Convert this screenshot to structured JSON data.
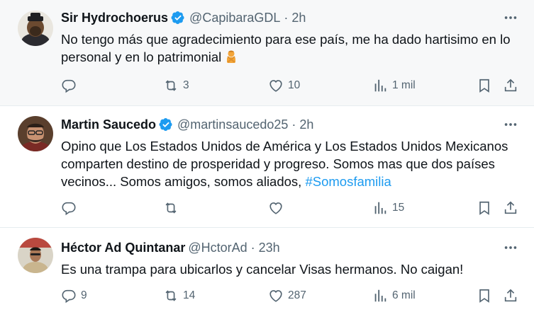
{
  "tweets": [
    {
      "name": "Sir Hydrochoerus",
      "handle": "@CapibaraGDL",
      "separator": "·",
      "time": "2h",
      "text": "No tengo más que  agradecimiento para ese país, me ha dado hartisimo en lo personal y en lo patrimonial",
      "emoji": "person-gesturing-no",
      "replies": "",
      "reposts": "3",
      "likes": "10",
      "views": "1 mil"
    },
    {
      "name": "Martin Saucedo",
      "handle": "@martinsaucedo25",
      "separator": "·",
      "time": "2h",
      "text": "Opino que Los Estados Unidos de América y Los Estados Unidos Mexicanos comparten destino de prosperidad y progreso.  Somos mas que dos países vecinos... Somos amigos, somos aliados, ",
      "hashtag": "#Somosfamilia",
      "replies": "",
      "reposts": "",
      "likes": "",
      "views": "15"
    },
    {
      "name": "Héctor Ad Quintanar",
      "handle": "@HctorAd",
      "separator": "·",
      "time": "23h",
      "text": "Es una trampa para ubicarlos y cancelar Visas hermanos. No caigan!",
      "replies": "9",
      "reposts": "14",
      "likes": "287",
      "views": "6 mil"
    }
  ],
  "colors": {
    "verified": "#1d9bf0",
    "muted": "#536471",
    "text": "#0f1419",
    "hashtag": "#1d9bf0",
    "highlight_bg": "#f7f8f9"
  }
}
